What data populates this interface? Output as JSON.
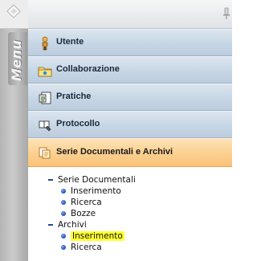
{
  "side_panel": {
    "label": "Menu"
  },
  "menu": {
    "items": [
      {
        "label": "Utente",
        "icon": "user-icon"
      },
      {
        "label": "Collaborazione",
        "icon": "folder-icon"
      },
      {
        "label": "Pratiche",
        "icon": "document-icon"
      },
      {
        "label": "Protocollo",
        "icon": "stamp-icon"
      },
      {
        "label": "Serie Documentali e Archivi",
        "icon": "copy-icon",
        "active": true
      }
    ]
  },
  "tree": {
    "groups": [
      {
        "label": "Serie Documentali",
        "children": [
          "Inserimento",
          "Ricerca",
          "Bozze"
        ]
      },
      {
        "label": "Archivi",
        "children": [
          "Inserimento",
          "Ricerca"
        ]
      }
    ],
    "selected": "Archivi > Inserimento"
  },
  "colors": {
    "item_bg": "#c7d6e5",
    "active_bg": "#fcd191",
    "highlight": "#ffff33",
    "bullet": "#1f4bb8"
  }
}
